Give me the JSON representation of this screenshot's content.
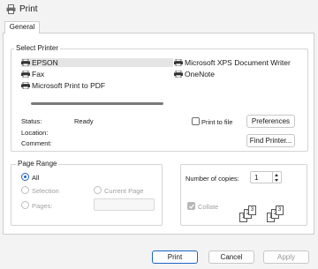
{
  "window": {
    "title": "Print"
  },
  "tabs": [
    {
      "label": "General"
    }
  ],
  "select_printer": {
    "label": "Select Printer",
    "printers": [
      {
        "name": "EPSON",
        "selected": true
      },
      {
        "name": "Fax",
        "selected": false
      },
      {
        "name": "Microsoft Print to PDF",
        "selected": false
      },
      {
        "name": "Microsoft XPS Document Writer",
        "selected": false
      },
      {
        "name": "OneNote",
        "selected": false
      }
    ],
    "status_label": "Status:",
    "status_value": "Ready",
    "location_label": "Location:",
    "comment_label": "Comment:",
    "print_to_file_label": "Print to file",
    "preferences_label": "Preferences",
    "find_printer_label": "Find Printer..."
  },
  "page_range": {
    "label": "Page Range",
    "all_label": "All",
    "selection_label": "Selection",
    "current_page_label": "Current Page",
    "pages_label": "Pages:",
    "pages_value": ""
  },
  "copies": {
    "number_label": "Number of copies:",
    "value": "1",
    "collate_label": "Collate",
    "stack1": [
      "1",
      "2",
      "3"
    ],
    "stack2": [
      "1",
      "2",
      "3"
    ]
  },
  "footer": {
    "print_label": "Print",
    "cancel_label": "Cancel",
    "apply_label": "Apply"
  },
  "colors": {
    "accent": "#1f63c5",
    "selection_bg": "#e5e5e5"
  },
  "icons": {
    "title": "printer-icon",
    "printer": "printer-icon"
  }
}
